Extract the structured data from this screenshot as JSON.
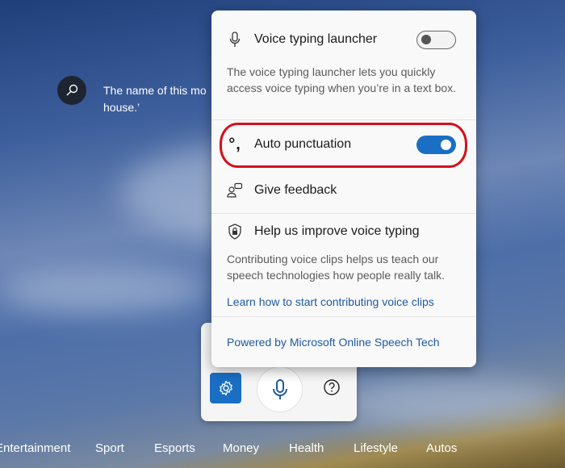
{
  "background": {
    "search_text": "The name of this mo house.’",
    "search_text_lines": [
      "The name of this mo",
      "house.’"
    ]
  },
  "nav": [
    "Entertainment",
    "Sport",
    "Esports",
    "Money",
    "Health",
    "Lifestyle",
    "Autos"
  ],
  "panel": {
    "launcher": {
      "label": "Voice typing launcher",
      "enabled": false,
      "description": "The voice typing launcher lets you quickly access voice typing when you’re in a text box."
    },
    "auto_punctuation": {
      "label": "Auto punctuation",
      "enabled": true
    },
    "feedback": {
      "label": "Give feedback"
    },
    "improve": {
      "label": "Help us improve voice typing",
      "description": "Contributing voice clips helps us teach our speech technologies how people really talk.",
      "link": "Learn how to start contributing voice clips"
    },
    "powered_by": "Powered by Microsoft Online Speech Tech"
  },
  "colors": {
    "accent": "#1a6fc4",
    "highlight": "#d4101c"
  }
}
